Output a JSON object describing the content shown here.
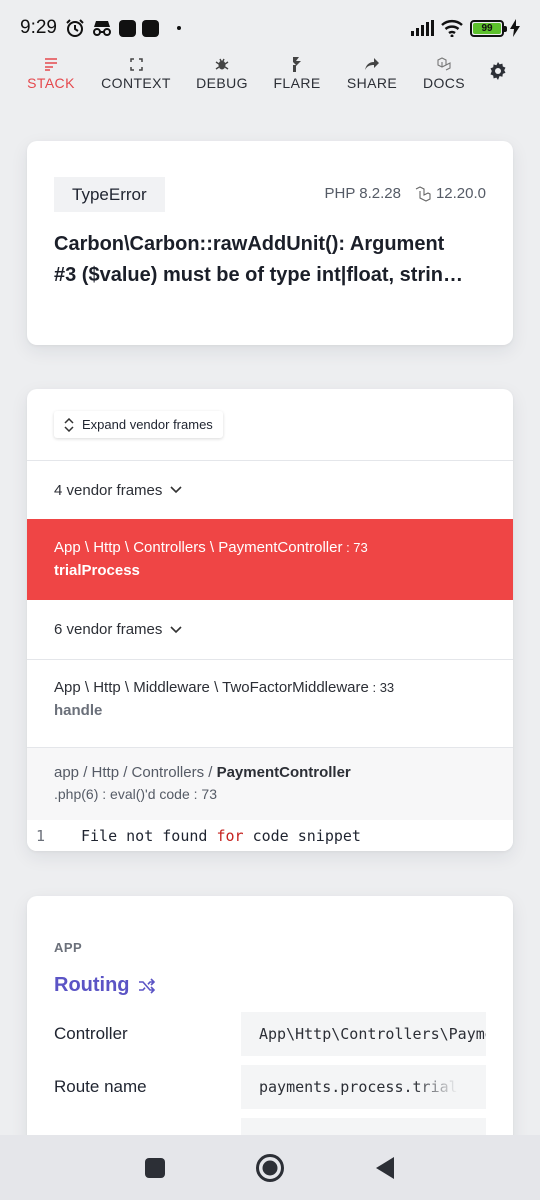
{
  "status_bar": {
    "time": "9:29",
    "battery": "99"
  },
  "nav": {
    "items": [
      {
        "label": "STACK",
        "icon": "stack-icon",
        "active": true
      },
      {
        "label": "CONTEXT",
        "icon": "expand-icon",
        "active": false
      },
      {
        "label": "DEBUG",
        "icon": "bug-icon",
        "active": false
      },
      {
        "label": "FLARE",
        "icon": "flare-icon",
        "active": false
      },
      {
        "label": "SHARE",
        "icon": "share-icon",
        "active": false
      },
      {
        "label": "DOCS",
        "icon": "docs-icon",
        "active": false
      }
    ],
    "settings_icon": "gear-icon",
    "active_color": "#e5484d"
  },
  "exception": {
    "type": "TypeError",
    "php_version": "PHP 8.2.28",
    "laravel_version": "12.20.0",
    "message_line1": "Carbon\\Carbon::rawAddUnit(): Argument",
    "message_line2": "#3 ($value) must be of type int|float, strin…"
  },
  "stack": {
    "expand_label": "Expand vendor frames",
    "vendor_group_1": "4 vendor frames",
    "active_frame": {
      "class": "App \\ Http \\ Controllers \\ PaymentController",
      "line": " : 73",
      "method": "trialProcess"
    },
    "vendor_group_2": "6 vendor frames",
    "frame2": {
      "class": "App \\ Http \\ Middleware \\ TwoFactorMiddleware",
      "line": " : 33",
      "method": "handle"
    },
    "snippet": {
      "path_prefix": "app / Http / Controllers / ",
      "path_file": "PaymentController",
      "path_suffix": ".php(6) : eval()'d code : 73",
      "line_number": "1",
      "code_before": "File not found ",
      "code_keyword": "for",
      "code_after": " code snippet"
    },
    "active_color": "#ef4545"
  },
  "app": {
    "section_label": "APP",
    "routing_title": "Routing",
    "rows": [
      {
        "key": "Controller",
        "value": "App\\Http\\Controllers\\PaymentController"
      },
      {
        "key": "Route name",
        "value": "payments.process.trial"
      }
    ],
    "accent_color": "#5b54c5"
  }
}
